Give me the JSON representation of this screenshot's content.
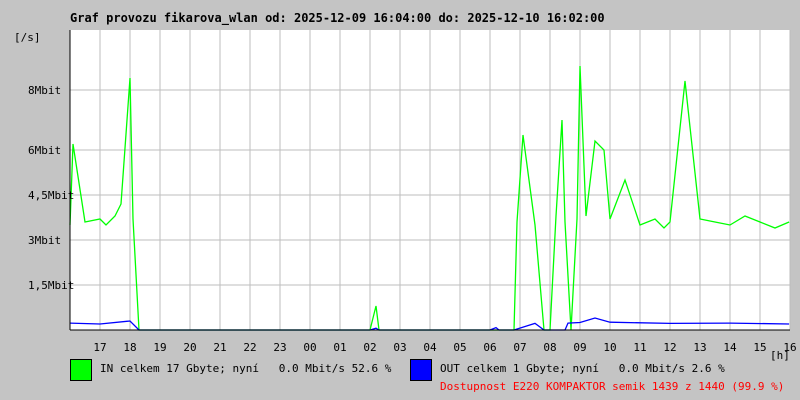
{
  "chart_data": {
    "type": "line",
    "title": "Graf provozu fikarova_wlan od: 2025-12-09 16:04:00 do: 2025-12-10 16:02:00",
    "ylabel": "[/s]",
    "xlabel": "[h]",
    "ylim": [
      0,
      10000000
    ],
    "x_ticks": [
      "17",
      "18",
      "19",
      "20",
      "21",
      "22",
      "23",
      "00",
      "01",
      "02",
      "03",
      "04",
      "05",
      "06",
      "07",
      "08",
      "09",
      "10",
      "11",
      "12",
      "13",
      "14",
      "15",
      "16"
    ],
    "y_ticks": [
      {
        "value": 1500000,
        "label": "1,5Mbit"
      },
      {
        "value": 3000000,
        "label": "3Mbit"
      },
      {
        "value": 4500000,
        "label": "4,5Mbit"
      },
      {
        "value": 6000000,
        "label": "6Mbit"
      },
      {
        "value": 8000000,
        "label": "8Mbit"
      }
    ],
    "x_unit": "hours since 16:00",
    "grid": true,
    "series": [
      {
        "name": "IN",
        "color": "#00ff00",
        "x": [
          0.0,
          0.1,
          0.5,
          1.0,
          1.2,
          1.5,
          1.7,
          2.0,
          2.1,
          2.3,
          10.0,
          10.2,
          10.3,
          10.5,
          14.8,
          14.9,
          15.1,
          15.5,
          15.8,
          16.0,
          16.2,
          16.4,
          16.5,
          16.7,
          16.9,
          17.0,
          17.2,
          17.5,
          17.8,
          18.0,
          18.5,
          19.0,
          19.5,
          19.8,
          20.0,
          20.5,
          21.0,
          21.5,
          22.0,
          22.5,
          23.0,
          23.5,
          23.97
        ],
        "values": [
          3500000,
          6200000,
          3600000,
          3700000,
          3500000,
          3800000,
          4200000,
          8400000,
          3700000,
          0,
          0,
          800000,
          0,
          0,
          0,
          3600000,
          6500000,
          3500000,
          0,
          0,
          3800000,
          7000000,
          3600000,
          0,
          3700000,
          8800000,
          3800000,
          6300000,
          6000000,
          3700000,
          5000000,
          3500000,
          3700000,
          3400000,
          3600000,
          8300000,
          3700000,
          3600000,
          3500000,
          3800000,
          3600000,
          3400000,
          3600000
        ]
      },
      {
        "name": "OUT",
        "color": "#0000ff",
        "x": [
          0.0,
          1.0,
          2.0,
          2.3,
          10.0,
          10.2,
          10.3,
          14.0,
          14.2,
          14.3,
          14.8,
          15.5,
          15.8,
          16.5,
          16.6,
          17.0,
          17.5,
          18.0,
          20.0,
          22.0,
          23.97
        ],
        "values": [
          230000,
          200000,
          300000,
          0,
          0,
          60000,
          0,
          0,
          80000,
          0,
          0,
          220000,
          0,
          0,
          230000,
          250000,
          400000,
          260000,
          220000,
          230000,
          200000
        ]
      }
    ]
  },
  "legend": {
    "in_text": "IN celkem 17 Gbyte; nyní   0.0 Mbit/s 52.6 %",
    "out_text": "OUT celkem 1 Gbyte; nyní   0.0 Mbit/s 2.6 %",
    "availability_text": "Dostupnost E220 KOMPAKTOR semik 1439 z 1440 (99.9 %)",
    "availability_color": "#ff0000"
  }
}
